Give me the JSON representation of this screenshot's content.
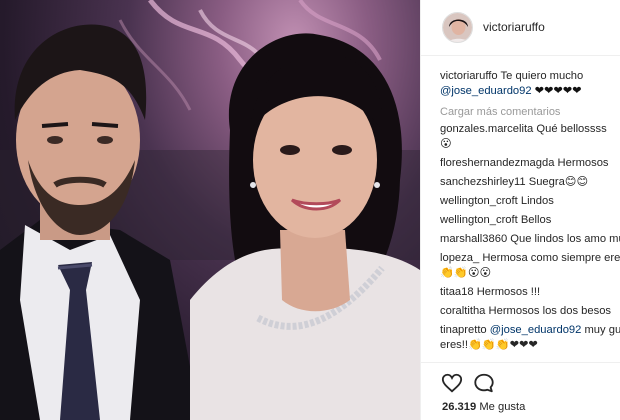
{
  "post": {
    "username": "victoriaruffo",
    "caption_user": "victoriaruffo",
    "caption_text": "Te quiero mucho",
    "caption_mention": "@jose_eduardo92",
    "caption_hearts": "❤❤❤❤❤",
    "load_more": "Cargar más comentarios",
    "likes": "26.319",
    "likes_label": "Me gusta"
  },
  "comments": [
    {
      "user": "gonzales.marcelita",
      "text": "Qué bellossss",
      "line2": "😮"
    },
    {
      "user": "floreshernandezmagda",
      "text": "Hermosos"
    },
    {
      "user": "sanchezshirley11",
      "text": "Suegra😊😊"
    },
    {
      "user": "wellington_croft",
      "text": "Lindos"
    },
    {
      "user": "wellington_croft",
      "text": "Bellos"
    },
    {
      "user": "marshall3860",
      "text": "Que lindos los amo mu"
    },
    {
      "user": "lopeza_",
      "text": "Hermosa como siempre eres",
      "line2": "👏👏😮😮"
    },
    {
      "user": "titaa18",
      "text": "Hermosos !!!"
    },
    {
      "user": "coraltitha",
      "text": "Hermosos los dos besos"
    },
    {
      "user": "tinapretto",
      "mention": "@jose_eduardo92",
      "text": "muy gu",
      "line2": "eres!!👏👏👏❤❤❤"
    }
  ],
  "icons": {
    "like": "heart-outline-icon",
    "comment": "speech-bubble-icon"
  }
}
